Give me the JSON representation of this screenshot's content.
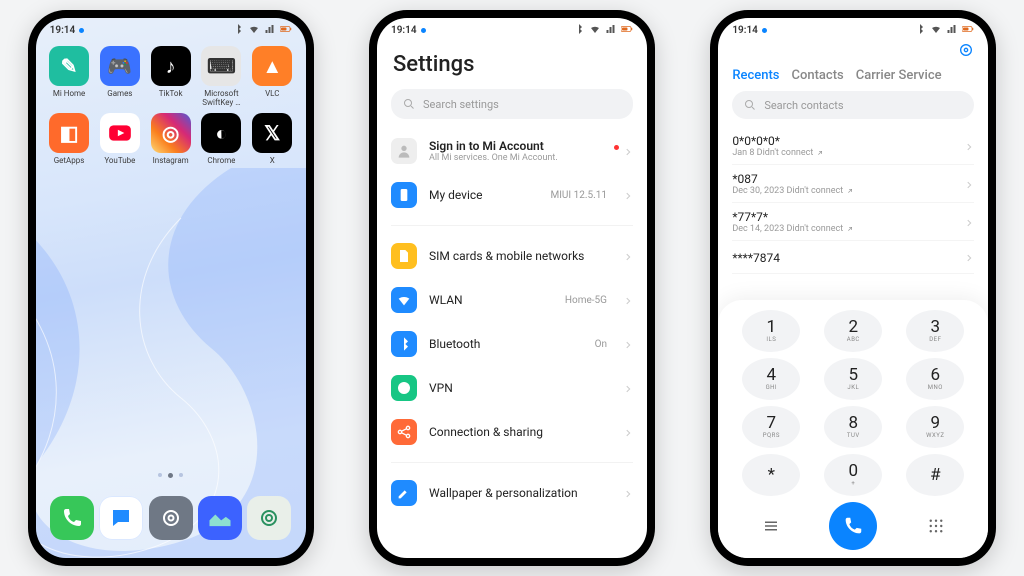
{
  "status": {
    "time": "19:14",
    "bt": "*",
    "wifi": "wifi",
    "sig": "sig",
    "batt": "batt"
  },
  "home": {
    "apps": [
      {
        "label": "Mi Home",
        "color": "#1fbea0",
        "glyph": "✎"
      },
      {
        "label": "Games",
        "color": "#3a72ff",
        "glyph": "🎮"
      },
      {
        "label": "TikTok",
        "color": "#000000",
        "glyph": "♪"
      },
      {
        "label": "Microsoft SwiftKey …",
        "color": "#e6e6e6",
        "glyph": "⌨",
        "dark": true
      },
      {
        "label": "VLC",
        "color": "#ff7f27",
        "glyph": "▲"
      },
      {
        "label": "GetApps",
        "color": "#ff6a2b",
        "glyph": "◧"
      },
      {
        "label": "YouTube",
        "color": "#ffffff",
        "glyph": "▶",
        "yt": true
      },
      {
        "label": "Instagram",
        "color": "grad-ig",
        "glyph": "◎"
      },
      {
        "label": "Chrome",
        "color": "#000000",
        "glyph": "◐"
      },
      {
        "label": "X",
        "color": "#000000",
        "glyph": "𝕏"
      }
    ],
    "dock": [
      {
        "name": "phone-app",
        "color": "#37c759",
        "glyph": "phone"
      },
      {
        "name": "messages-app",
        "color": "#ffffff",
        "glyph": "chat",
        "blue": true
      },
      {
        "name": "settings-app",
        "color": "#6f7885",
        "glyph": "gear"
      },
      {
        "name": "gallery-app",
        "color": "#3c62ff",
        "glyph": "gallery"
      },
      {
        "name": "camera-app",
        "color": "#e9efe9",
        "glyph": "camera",
        "dark": true
      }
    ]
  },
  "settings": {
    "title": "Settings",
    "search_ph": "Search settings",
    "account": {
      "title": "Sign in to Mi Account",
      "sub": "All Mi services. One Mi Account."
    },
    "items": [
      {
        "icon": "phone",
        "color": "#1f8bff",
        "label": "My device",
        "value": "MIUI 12.5.11"
      },
      {
        "sep": true
      },
      {
        "icon": "sim",
        "color": "#ffbf1f",
        "label": "SIM cards & mobile networks"
      },
      {
        "icon": "wifi",
        "color": "#1f8bff",
        "label": "WLAN",
        "value": "Home-5G"
      },
      {
        "icon": "bt",
        "color": "#1f8bff",
        "label": "Bluetooth",
        "value": "On"
      },
      {
        "icon": "vpn",
        "color": "#17c684",
        "label": "VPN"
      },
      {
        "icon": "share",
        "color": "#ff6a38",
        "label": "Connection & sharing"
      },
      {
        "sep": true
      },
      {
        "icon": "brush",
        "color": "#1f8bff",
        "label": "Wallpaper & personalization"
      }
    ]
  },
  "dialer": {
    "tabs": [
      "Recents",
      "Contacts",
      "Carrier Service"
    ],
    "active_tab": 0,
    "search_ph": "Search contacts",
    "log": [
      {
        "num": "0*0*0*0*",
        "meta": "Jan 8 Didn't connect"
      },
      {
        "num": "*087",
        "meta": "Dec 30, 2023 Didn't connect"
      },
      {
        "num": "*77*7*",
        "meta": "Dec 14, 2023 Didn't connect"
      },
      {
        "num": "****7874",
        "meta": ""
      }
    ],
    "keys": [
      [
        "1",
        "ILS"
      ],
      [
        "2",
        "ABC"
      ],
      [
        "3",
        "DEF"
      ],
      [
        "4",
        "GHI"
      ],
      [
        "5",
        "JKL"
      ],
      [
        "6",
        "MNO"
      ],
      [
        "7",
        "PQRS"
      ],
      [
        "8",
        "TUV"
      ],
      [
        "9",
        "WXYZ"
      ],
      [
        "*",
        ""
      ],
      [
        "0",
        "+"
      ],
      [
        "#",
        ""
      ]
    ]
  }
}
